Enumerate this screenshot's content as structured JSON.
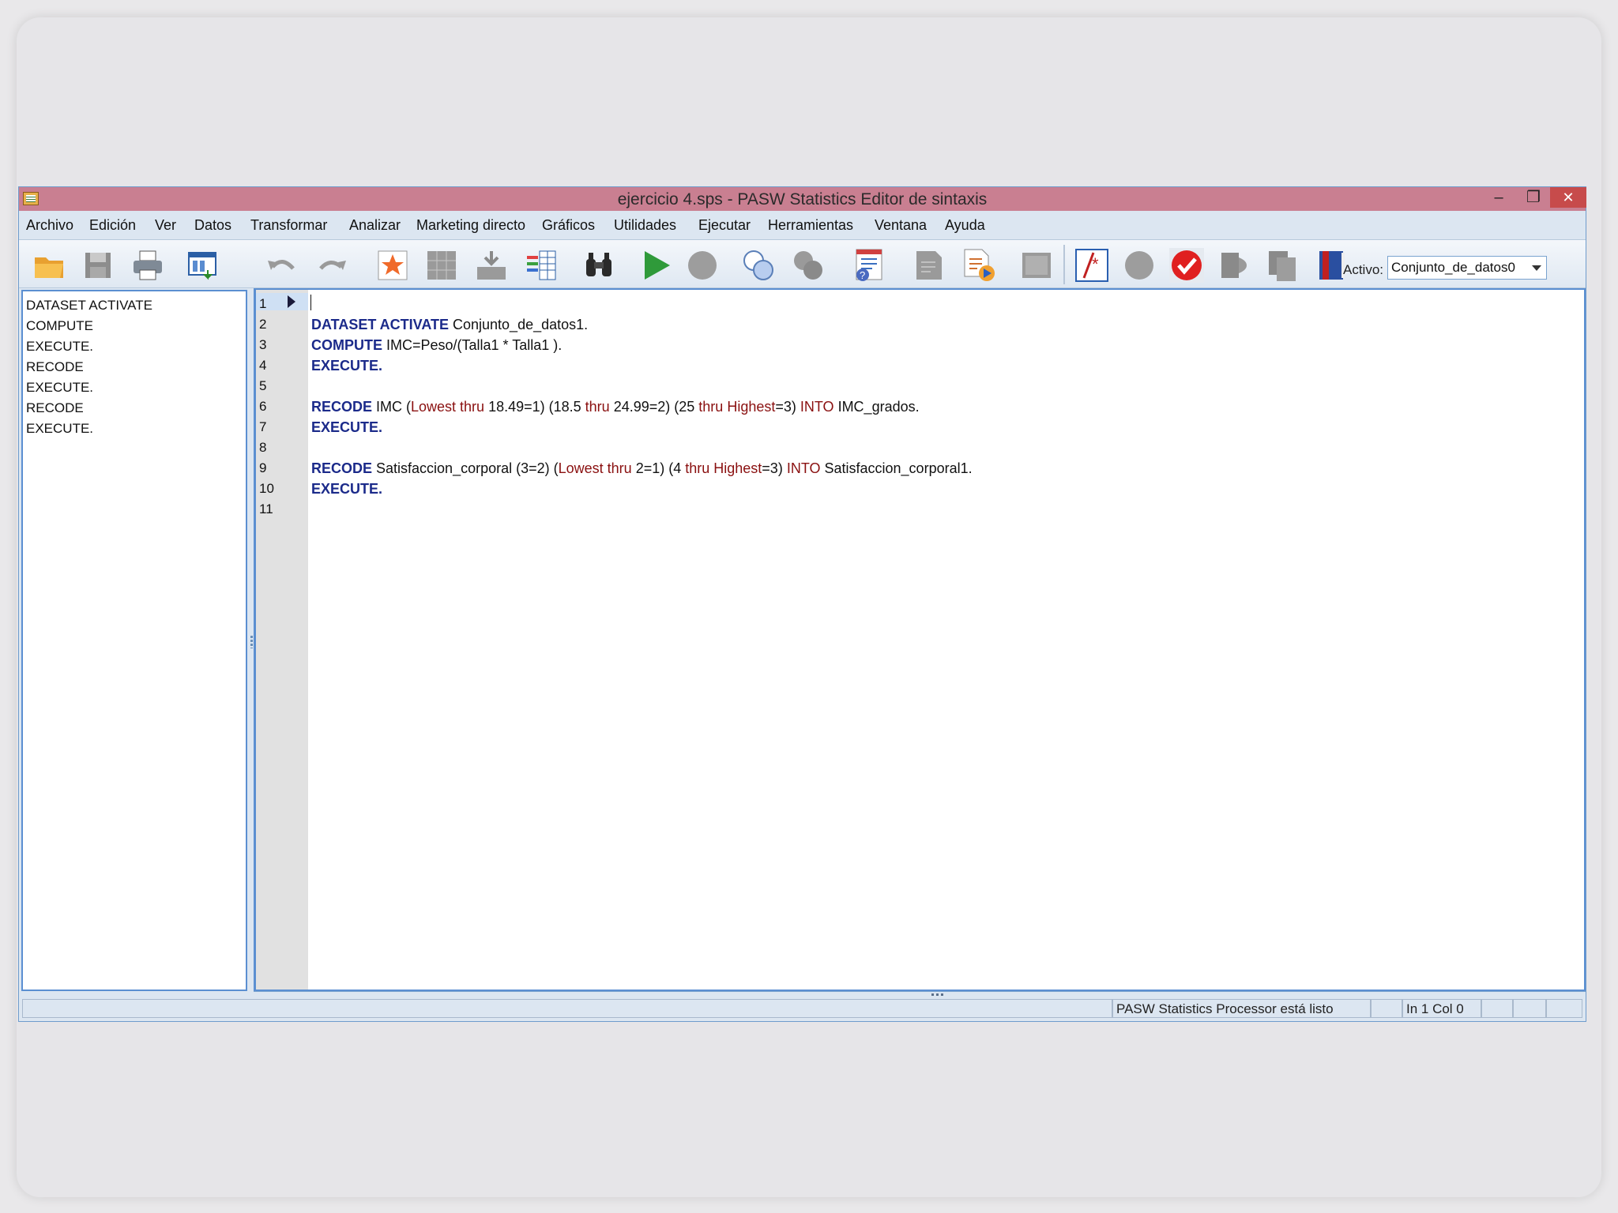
{
  "window": {
    "title": "ejercicio 4.sps - PASW Statistics Editor de sintaxis",
    "minimize_glyph": "–",
    "restore_glyph": "❐",
    "close_glyph": "✕"
  },
  "menu": [
    "Archivo",
    "Edición",
    "Ver",
    "Datos",
    "Transformar",
    "Analizar",
    "Marketing directo",
    "Gráficos",
    "Utilidades",
    "Ejecutar",
    "Herramientas",
    "Ventana",
    "Ayuda"
  ],
  "toolbar": {
    "icons": [
      "open-folder-icon",
      "save-icon",
      "print-icon",
      "dialog-recall-icon",
      "undo-icon",
      "redo-icon",
      "goto-case-icon",
      "goto-variable-icon",
      "insert-case-icon",
      "variables-icon",
      "find-icon",
      "run-icon",
      "stop-icon",
      "circles-icon",
      "grey-circles-icon",
      "syntax-help-icon",
      "grey-doc-icon",
      "doc-arrow-icon",
      "grey-square-icon",
      "comment-icon",
      "breakpoint-icon",
      "check-icon",
      "grey-book-icon",
      "grey-pages-icon",
      "bookmark-book-icon"
    ],
    "active_label": "Activo:",
    "active_value": "Conjunto_de_datos0"
  },
  "navigator": [
    "DATASET ACTIVATE",
    "COMPUTE",
    "EXECUTE.",
    "RECODE",
    "EXECUTE.",
    "RECODE",
    "EXECUTE."
  ],
  "editor": {
    "line_numbers": [
      "1",
      "2",
      "3",
      "4",
      "5",
      "6",
      "7",
      "8",
      "9",
      "10",
      "11"
    ],
    "lines": [
      [],
      [
        {
          "t": "DATASET ACTIVATE",
          "c": "kw"
        },
        {
          "t": " Conjunto_de_datos1.",
          "c": ""
        }
      ],
      [
        {
          "t": "COMPUTE",
          "c": "kw"
        },
        {
          "t": " IMC=Peso/(Talla1 * Talla1 ).",
          "c": ""
        }
      ],
      [
        {
          "t": "EXECUTE.",
          "c": "kw"
        }
      ],
      [],
      [
        {
          "t": "RECODE",
          "c": "kw"
        },
        {
          "t": " IMC (",
          "c": ""
        },
        {
          "t": "Lowest thru",
          "c": "red"
        },
        {
          "t": " 18.49=1) (18.5 ",
          "c": ""
        },
        {
          "t": "thru",
          "c": "red"
        },
        {
          "t": " 24.99=2) (25 ",
          "c": ""
        },
        {
          "t": "thru Highest",
          "c": "red"
        },
        {
          "t": "=3) ",
          "c": ""
        },
        {
          "t": "INTO",
          "c": "red"
        },
        {
          "t": " IMC_grados.",
          "c": ""
        }
      ],
      [
        {
          "t": "EXECUTE.",
          "c": "kw"
        }
      ],
      [],
      [
        {
          "t": "RECODE",
          "c": "kw"
        },
        {
          "t": " Satisfaccion_corporal (3=2) (",
          "c": ""
        },
        {
          "t": "Lowest thru",
          "c": "red"
        },
        {
          "t": " 2=1) (4 ",
          "c": ""
        },
        {
          "t": "thru Highest",
          "c": "red"
        },
        {
          "t": "=3) ",
          "c": ""
        },
        {
          "t": "INTO",
          "c": "red"
        },
        {
          "t": " Satisfaccion_corporal1.",
          "c": ""
        }
      ],
      [
        {
          "t": "EXECUTE.",
          "c": "kw"
        }
      ],
      []
    ]
  },
  "status": {
    "processor": "PASW Statistics Processor está listo",
    "position": "In 1 Col 0"
  }
}
